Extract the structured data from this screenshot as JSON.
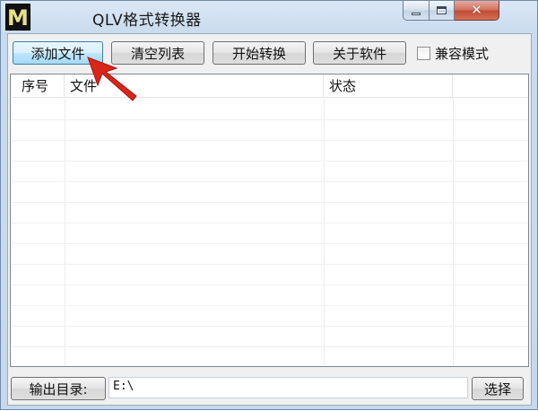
{
  "window": {
    "title": "QLV格式转换器",
    "app_icon_letter": "M",
    "controls": {
      "minimize": "minimize",
      "maximize": "maximize",
      "close": "✕"
    }
  },
  "toolbar": {
    "add_file": "添加文件",
    "clear_list": "清空列表",
    "start_convert": "开始转换",
    "about": "关于软件",
    "compat_mode_label": "兼容模式",
    "compat_mode_checked": false
  },
  "list": {
    "columns": [
      "序号",
      "文件",
      "状态",
      ""
    ],
    "rows": []
  },
  "bottom": {
    "output_dir_label": "输出目录:",
    "output_path": "E:\\",
    "select_button": "选择"
  },
  "colors": {
    "title_bar": "#c9dbee",
    "close_button": "#c14a34",
    "annotation_arrow": "#d8261b",
    "focused_button": "#bee6fd"
  },
  "icons": {
    "app": "app-logo-icon",
    "minimize": "minimize-icon",
    "maximize": "maximize-icon",
    "close": "close-icon",
    "pointer": "red-arrow-icon"
  }
}
